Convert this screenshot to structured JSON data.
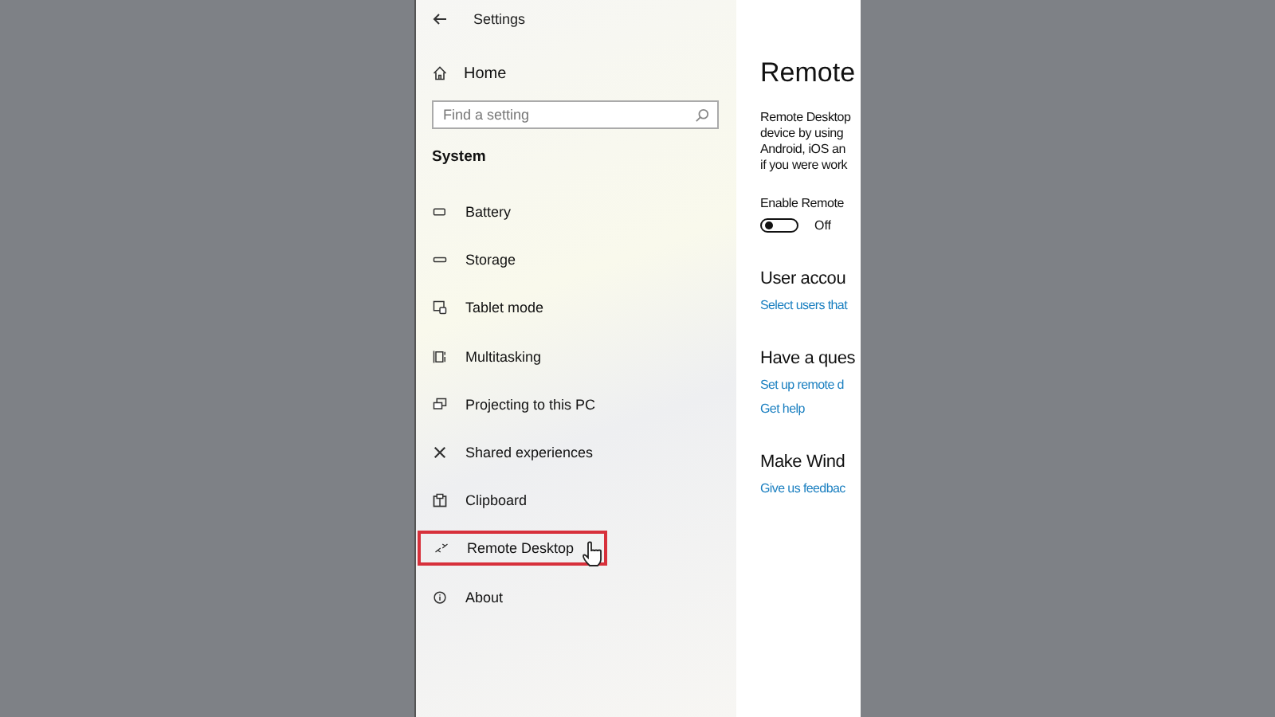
{
  "window": {
    "title": "Settings"
  },
  "home": {
    "label": "Home"
  },
  "search": {
    "placeholder": "Find a setting"
  },
  "section": "System",
  "nav_items": [
    {
      "label": "Battery",
      "kind": "battery",
      "selected": false
    },
    {
      "label": "Storage",
      "kind": "storage",
      "selected": false
    },
    {
      "label": "Tablet mode",
      "kind": "tablet",
      "selected": false
    },
    {
      "label": "Multitasking",
      "kind": "multitask",
      "selected": false
    },
    {
      "label": "Projecting to this PC",
      "kind": "project",
      "selected": false
    },
    {
      "label": "Shared experiences",
      "kind": "shared",
      "selected": false
    },
    {
      "label": "Clipboard",
      "kind": "clipboard",
      "selected": false
    },
    {
      "label": "Remote Desktop",
      "kind": "remote",
      "selected": true
    },
    {
      "label": "About",
      "kind": "about",
      "selected": false
    }
  ],
  "page": {
    "title": "Remote",
    "description": [
      "Remote Desktop",
      "device by using",
      "Android, iOS an",
      "if you were work"
    ],
    "toggle": {
      "label": "Enable Remote",
      "on": false,
      "state_text": "Off"
    },
    "sections": [
      {
        "heading": "User accou",
        "links": [
          "Select users that"
        ]
      },
      {
        "heading": "Have a ques",
        "links": [
          "Set up remote d",
          "Get help"
        ]
      },
      {
        "heading": "Make Wind",
        "links": [
          "Give us feedbac"
        ]
      }
    ]
  }
}
